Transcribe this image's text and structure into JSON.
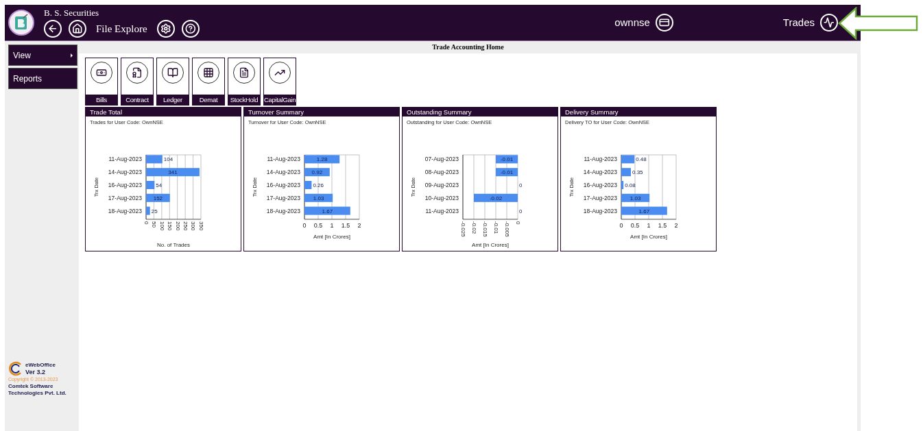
{
  "header": {
    "company": "B. S. Securities",
    "location": "File Explore",
    "user": "ownnse",
    "module": "Trades"
  },
  "sidebar": {
    "items": [
      {
        "label": "View",
        "kind": "submenu"
      },
      {
        "label": "Reports",
        "kind": "link"
      }
    ]
  },
  "footer": {
    "product": "eWebOffice",
    "version": "Ver 3.2",
    "copyright": "Copyright © 2013-2023",
    "company_lines": [
      "Comtek Software",
      "Technologies Pvt. Ltd."
    ]
  },
  "page_title": "Trade Accounting Home",
  "tiles": [
    {
      "label": "Bills",
      "kind": "bills"
    },
    {
      "label": "Contract",
      "kind": "contract"
    },
    {
      "label": "Ledger",
      "kind": "ledger"
    },
    {
      "label": "Demat",
      "kind": "demat"
    },
    {
      "label": "StockHold",
      "kind": "stockhold"
    },
    {
      "label": "CapitalGain",
      "kind": "capitalgain"
    }
  ],
  "panels": [
    {
      "title": "Trade Total",
      "subtitle": "Trades for User Code: OwnNSE",
      "chart_data": {
        "type": "bar",
        "orientation": "horizontal",
        "xlabel": "No. of Trades",
        "ylabel": "Trx Date",
        "categories": [
          "11-Aug-2023",
          "14-Aug-2023",
          "16-Aug-2023",
          "17-Aug-2023",
          "18-Aug-2023"
        ],
        "values": [
          104,
          341,
          54,
          152,
          25
        ],
        "xlim": [
          0,
          350
        ],
        "xticks": [
          0,
          50,
          100,
          150,
          200,
          250,
          300,
          350
        ],
        "grid": true,
        "data_labels": true
      }
    },
    {
      "title": "Turnover Summary",
      "subtitle": "Turnover for User Code: OwnNSE",
      "chart_data": {
        "type": "bar",
        "orientation": "horizontal",
        "xlabel": "Amt [In Crores]",
        "ylabel": "Trx Date",
        "categories": [
          "11-Aug-2023",
          "14-Aug-2023",
          "16-Aug-2023",
          "17-Aug-2023",
          "18-Aug-2023"
        ],
        "values": [
          1.28,
          0.92,
          0.26,
          1.03,
          1.67
        ],
        "xlim": [
          0,
          2
        ],
        "xticks": [
          0,
          0.5,
          1,
          1.5,
          2
        ],
        "grid": true,
        "data_labels": true
      }
    },
    {
      "title": "Outstanding Summary",
      "subtitle": "Outstanding for User Code: OwnNSE",
      "chart_data": {
        "type": "bar",
        "orientation": "horizontal",
        "xlabel": "Amt [In Crores]",
        "ylabel": "Trx Date",
        "categories": [
          "07-Aug-2023",
          "08-Aug-2023",
          "09-Aug-2023",
          "10-Aug-2023",
          "11-Aug-2023"
        ],
        "values": [
          -0.01,
          -0.01,
          0,
          -0.02,
          0
        ],
        "xlim": [
          -0.025,
          0
        ],
        "xticks": [
          -0.025,
          -0.02,
          -0.015,
          -0.01,
          -0.005,
          0
        ],
        "grid": true,
        "data_labels": true
      }
    },
    {
      "title": "Delivery Summary",
      "subtitle": "Delivery TO for User Code: OwnNSE",
      "chart_data": {
        "type": "bar",
        "orientation": "horizontal",
        "xlabel": "Amt [In Crores]",
        "ylabel": "Trx Date",
        "categories": [
          "11-Aug-2023",
          "14-Aug-2023",
          "16-Aug-2023",
          "17-Aug-2023",
          "18-Aug-2023"
        ],
        "values": [
          0.48,
          0.35,
          0.08,
          1.03,
          1.67
        ],
        "xlim": [
          0,
          2
        ],
        "xticks": [
          0,
          0.5,
          1,
          1.5,
          2
        ],
        "grid": true,
        "data_labels": true
      }
    }
  ]
}
